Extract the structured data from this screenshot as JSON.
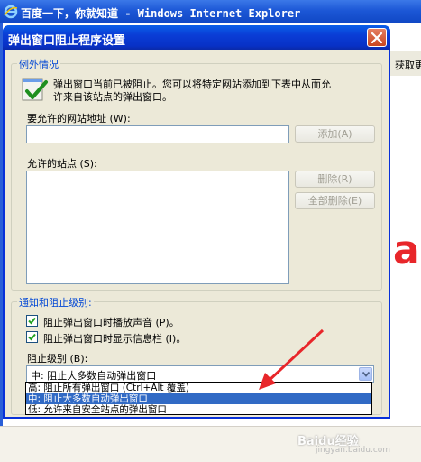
{
  "browser": {
    "title": "百度一下，你就知道 - Windows Internet Explorer",
    "right_fragment": "获取更",
    "brand_fragment": "ai"
  },
  "dialog": {
    "title": "弹出窗口阻止程序设置",
    "exceptions": {
      "legend": "例外情况",
      "description_line1": "弹出窗口当前已被阻止。您可以将特定网站添加到下表中从而允",
      "description_line2": "许来自该站点的弹出窗口。",
      "address_label": "要允许的网站地址 (W):",
      "address_value": "",
      "add_button": "添加(A)",
      "allowed_label": "允许的站点 (S):",
      "allowed_sites": [],
      "remove_button": "删除(R)",
      "remove_all_button": "全部删除(E)"
    },
    "notification": {
      "legend": "通知和阻止级别:",
      "play_sound_label": "阻止弹出窗口时播放声音 (P)。",
      "play_sound_checked": true,
      "show_infobar_label": "阻止弹出窗口时显示信息栏 (I)。",
      "show_infobar_checked": true,
      "level_label": "阻止级别 (B):",
      "level_selected": "中: 阻止大多数自动弹出窗口",
      "level_options": [
        "高: 阻止所有弹出窗口 (Ctrl+Alt 覆盖)",
        "中: 阻止大多数自动弹出窗口",
        "低: 允许来自安全站点的弹出窗口"
      ],
      "highlighted_option_index": 1
    }
  },
  "annotation": {
    "arrow_color": "#e8262a"
  },
  "watermark": {
    "text": "Baidu经验",
    "subtext": "jingyan.baidu.com"
  }
}
